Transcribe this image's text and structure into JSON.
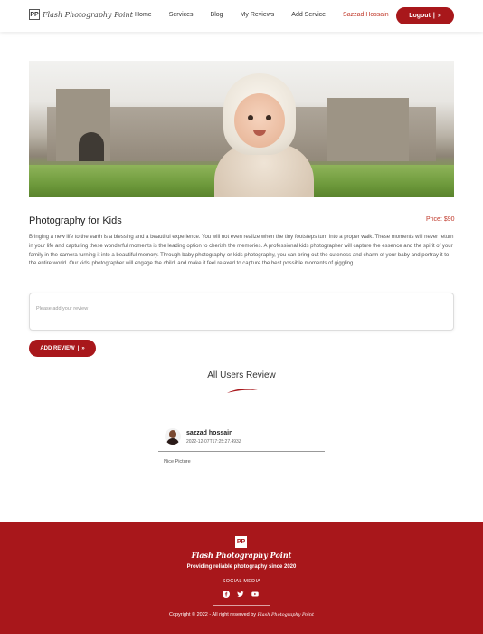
{
  "header": {
    "logo_mark": "PP",
    "logo_text": "Flash Photography Point",
    "nav": [
      "Home",
      "Services",
      "Blog",
      "My Reviews",
      "Add Service"
    ],
    "user_name": "Sazzad Hossain",
    "logout_label": "Logout",
    "logout_icon": "double-chevron-right-icon"
  },
  "service": {
    "title": "Photography for Kids",
    "price": "Price: $90",
    "description": "Bringing a new life to the earth is a blessing and a beautiful experience. You will not even realize when the tiny footsteps turn into a proper walk. These moments will never return in your life and capturing these wonderful moments is the leading option to cherish the memories. A professional kids photographer will capture the essence and the spirit of your family in the camera turning it into a beautiful memory. Through baby photography or kids photography, you can bring out the cuteness and charm of your baby and portray it to the entire world. Our kids' photographer will engage the child, and make it feel relaxed to capture the best possible moments of giggling."
  },
  "review_form": {
    "placeholder": "Please add your review",
    "submit_label": "ADD REVIEW"
  },
  "reviews_section": {
    "title": "All Users Review",
    "accent_color": "#a8171b",
    "reviews": [
      {
        "name": "sazzad hossain",
        "date": "2022-12-07T17:25:27.493Z",
        "text": "Nice Picture"
      }
    ]
  },
  "footer": {
    "logo_mark": "PP",
    "logo_text": "Flash Photography Point",
    "tagline": "Providing reliable photography since 2020",
    "social_label": "SOCIAL MEDIA",
    "social_icons": [
      "facebook-icon",
      "twitter-icon",
      "youtube-icon"
    ],
    "copyright": "Copyright © 2022 - All right reserved by",
    "copyright_brand": "Flash Photography Point",
    "background_color": "#a8171b"
  }
}
